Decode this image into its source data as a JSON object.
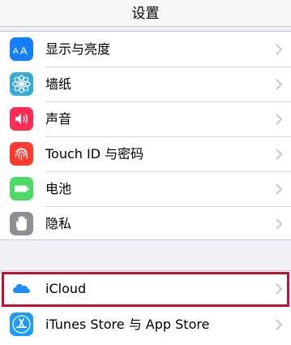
{
  "nav": {
    "title": "设置"
  },
  "group1": {
    "items": [
      {
        "label": "显示与亮度",
        "icon": "display-brightness-icon",
        "color": "#157efb"
      },
      {
        "label": "墙纸",
        "icon": "wallpaper-flower-icon",
        "color": "#35aadc"
      },
      {
        "label": "声音",
        "icon": "speaker-icon",
        "color": "#ff2d55"
      },
      {
        "label": "Touch ID 与密码",
        "icon": "fingerprint-icon",
        "color": "#ff3b30"
      },
      {
        "label": "电池",
        "icon": "battery-icon",
        "color": "#4cd964"
      },
      {
        "label": "隐私",
        "icon": "privacy-hand-icon",
        "color": "#8e8e93"
      }
    ]
  },
  "group2": {
    "items": [
      {
        "label": "iCloud",
        "icon": "icloud-icon",
        "color": "#1b8ef8",
        "highlighted": true
      },
      {
        "label": "iTunes Store 与 App Store",
        "icon": "app-store-icon",
        "color": "#1e9bf5"
      }
    ]
  },
  "colors": {
    "highlight": "#c8102e",
    "background": "#efeff4"
  }
}
